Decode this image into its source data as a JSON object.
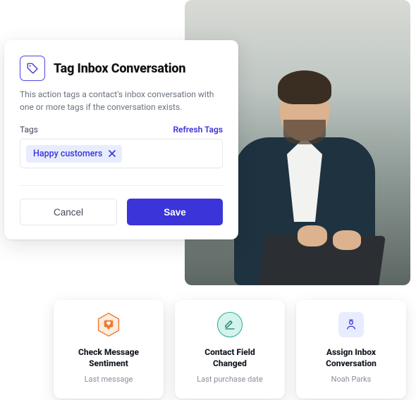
{
  "modal": {
    "title": "Tag Inbox Conversation",
    "description": "This action tags a contact's inbox conversation with one or more tags if the conversation exists.",
    "tags_label": "Tags",
    "refresh_label": "Refresh Tags",
    "chip_label": "Happy customers",
    "cancel_label": "Cancel",
    "save_label": "Save"
  },
  "cards": [
    {
      "title_line1": "Check Message",
      "title_line2": "Sentiment",
      "subtitle": "Last message"
    },
    {
      "title_line1": "Contact Field",
      "title_line2": "Changed",
      "subtitle": "Last purchase date"
    },
    {
      "title_line1": "Assign Inbox",
      "title_line2": "Conversation",
      "subtitle": "Noah Parks"
    }
  ],
  "colors": {
    "primary": "#3b34d8",
    "chip_bg": "#e7edff",
    "mint": "#d5f3ee",
    "mint_border": "#2aa793",
    "orange": "#ef7a2e"
  }
}
